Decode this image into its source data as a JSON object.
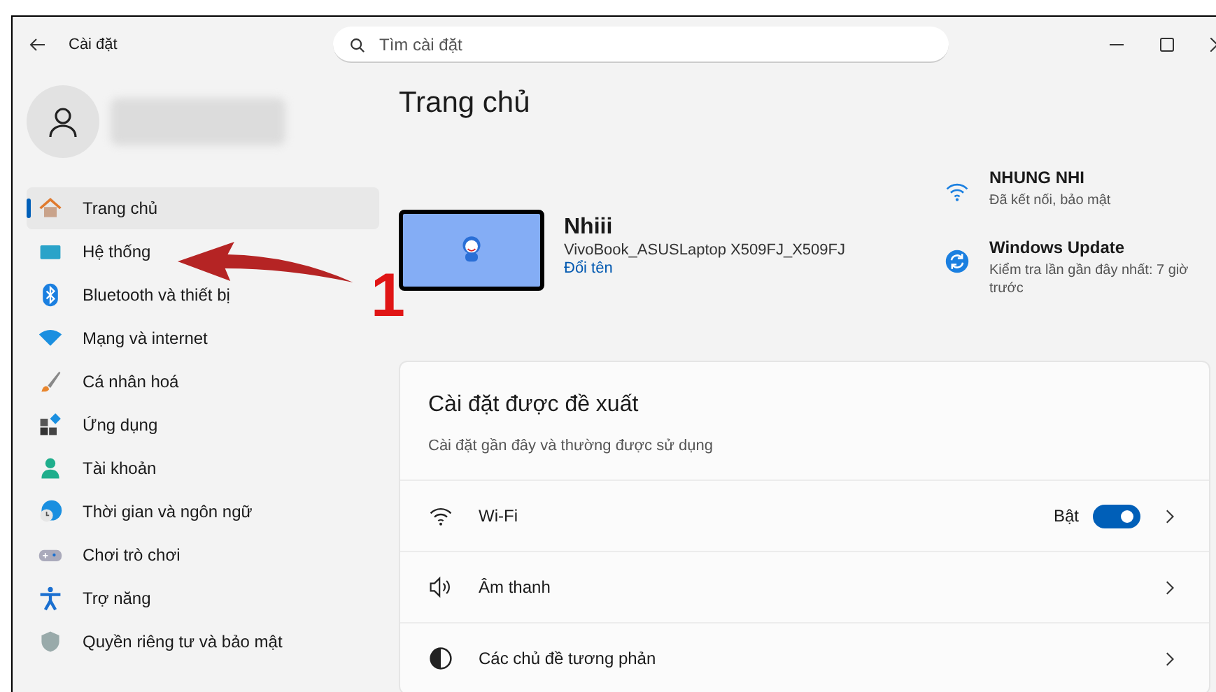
{
  "window": {
    "title": "Cài đặt"
  },
  "search": {
    "placeholder": "Tìm cài đặt"
  },
  "sidebar": {
    "items": [
      {
        "kind": "home",
        "label": "Trang chủ",
        "selected": true
      },
      {
        "kind": "system",
        "label": "Hệ thống",
        "selected": false
      },
      {
        "kind": "bluetooth",
        "label": "Bluetooth và thiết bị",
        "selected": false
      },
      {
        "kind": "network",
        "label": "Mạng và internet",
        "selected": false
      },
      {
        "kind": "brush",
        "label": "Cá nhân hoá",
        "selected": false
      },
      {
        "kind": "apps",
        "label": "Ứng dụng",
        "selected": false
      },
      {
        "kind": "account",
        "label": "Tài khoản",
        "selected": false
      },
      {
        "kind": "time",
        "label": "Thời gian và ngôn ngữ",
        "selected": false
      },
      {
        "kind": "gaming",
        "label": "Chơi trò chơi",
        "selected": false
      },
      {
        "kind": "accessibility",
        "label": "Trợ năng",
        "selected": false
      },
      {
        "kind": "privacy",
        "label": "Quyền riêng tư và bảo mật",
        "selected": false
      }
    ]
  },
  "page_title": "Trang chủ",
  "device": {
    "name": "Nhiii",
    "model": "VivoBook_ASUSLaptop X509FJ_X509FJ",
    "rename_link": "Đổi tên"
  },
  "status": [
    {
      "kind": "wifi",
      "title": "NHUNG NHI",
      "detail": "Đã kết nối, bảo mật"
    },
    {
      "kind": "update",
      "title": "Windows Update",
      "detail": "Kiểm tra lần gần đây nhất: 7 giờ trước"
    }
  ],
  "suggested": {
    "title": "Cài đặt được đề xuất",
    "subtitle": "Cài đặt gần đây và thường được sử dụng",
    "rows": [
      {
        "kind": "wifi",
        "label": "Wi-Fi",
        "state_label": "Bật",
        "on": true
      },
      {
        "kind": "sound",
        "label": "Âm thanh"
      },
      {
        "kind": "contrast",
        "label": "Các chủ đề tương phản"
      }
    ]
  },
  "annotation": {
    "label": "1"
  }
}
